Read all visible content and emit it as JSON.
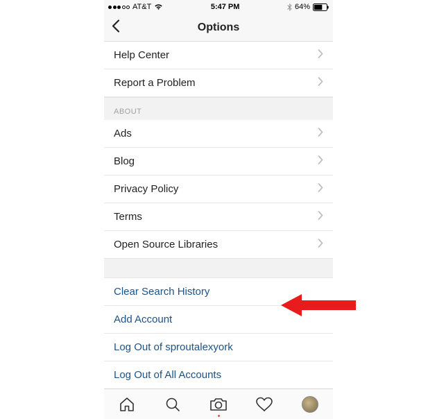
{
  "status": {
    "carrier": "AT&T",
    "time": "5:47 PM",
    "battery_pct": "64%"
  },
  "header": {
    "title": "Options"
  },
  "sections": {
    "support": {
      "help_center": "Help Center",
      "report_problem": "Report a Problem"
    },
    "about": {
      "header": "ABOUT",
      "ads": "Ads",
      "blog": "Blog",
      "privacy_policy": "Privacy Policy",
      "terms": "Terms",
      "open_source": "Open Source Libraries"
    },
    "account": {
      "clear_search": "Clear Search History",
      "add_account": "Add Account",
      "log_out_user": "Log Out of sproutalexyork",
      "log_out_all": "Log Out of All Accounts"
    }
  }
}
